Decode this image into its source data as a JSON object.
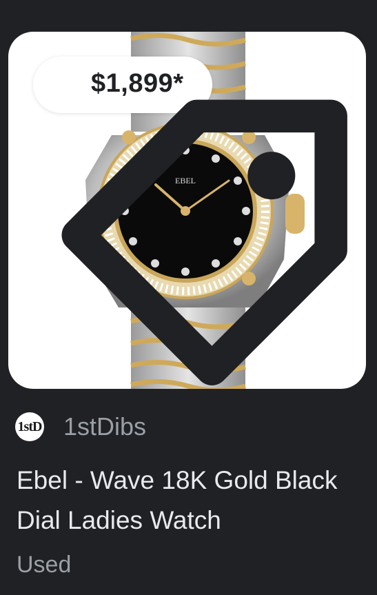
{
  "product": {
    "price": "$1,899*",
    "source": "1stDibs",
    "source_logo_text": "1stD",
    "title": "Ebel - Wave 18K Gold Black Dial Ladies Watch",
    "condition": "Used",
    "watch_brand": "EBEL"
  },
  "icons": {
    "price_tag": "tag-icon",
    "source_logo": "1stdibs-logo-icon"
  },
  "colors": {
    "background": "#202124",
    "card_image_bg": "#ffffff",
    "price_text": "#202124",
    "title_text": "#e8eaed",
    "secondary_text": "#9aa0a6",
    "gold": "#d4b36a",
    "steel": "#c9c9c9",
    "dial": "#0a0a0a"
  }
}
